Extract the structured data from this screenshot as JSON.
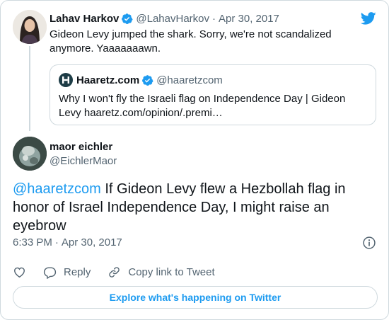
{
  "parent_tweet": {
    "author_name": "Lahav Harkov",
    "handle": "@LahavHarkov",
    "date": "Apr 30, 2017",
    "text": "Gideon Levy jumped the shark. Sorry, we're not scandalized anymore. Yaaaaaaawn.",
    "quoted": {
      "author_name": "Haaretz.com",
      "handle": "@haaretzcom",
      "text": "Why I won't fly the Israeli flag on Independence Day | Gideon Levy haaretz.com/opinion/.premi…"
    }
  },
  "main_tweet": {
    "author_name": "maor eichler",
    "handle": "@EichlerMaor",
    "mention": "@haaretzcom",
    "text": " If Gideon Levy flew a Hezbollah flag in honor of Israel Independence Day, I might raise an eyebrow",
    "time": "6:33 PM",
    "date": "Apr 30, 2017"
  },
  "actions": {
    "reply_label": "Reply",
    "copy_label": "Copy link to Tweet"
  },
  "explore_label": "Explore what's happening on Twitter",
  "colors": {
    "accent": "#1d9bf0",
    "muted": "#536471",
    "border": "#cfd9de"
  },
  "icons": [
    "twitter-logo-icon",
    "verified-badge-icon",
    "haaretz-logo-icon",
    "info-icon",
    "heart-icon",
    "reply-icon",
    "link-icon"
  ]
}
